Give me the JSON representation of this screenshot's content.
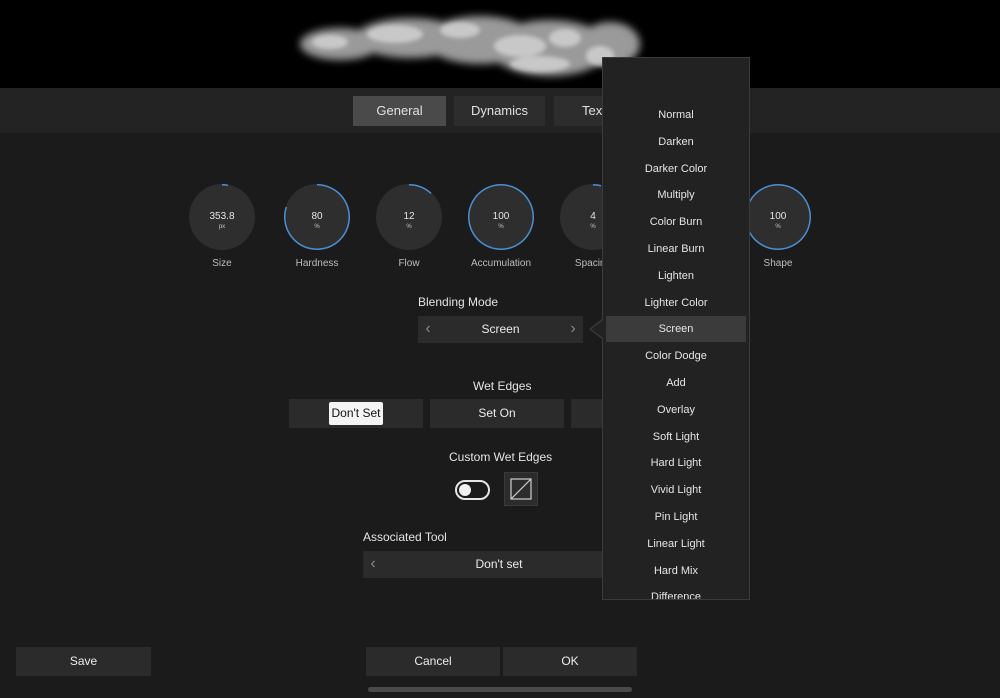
{
  "preview": {
    "icon": "brush-stroke-preview"
  },
  "tabs": [
    {
      "label": "General",
      "active": true
    },
    {
      "label": "Dynamics",
      "active": false
    },
    {
      "label": "Text",
      "active": false
    }
  ],
  "dials": [
    {
      "value": "353.8",
      "unit": "px",
      "label": "Size",
      "fill": 0.03
    },
    {
      "value": "80",
      "unit": "%",
      "label": "Hardness",
      "fill": 0.8
    },
    {
      "value": "12",
      "unit": "%",
      "label": "Flow",
      "fill": 0.12
    },
    {
      "value": "100",
      "unit": "%",
      "label": "Accumulation",
      "fill": 1.0
    },
    {
      "value": "4",
      "unit": "%",
      "label": "Spacing",
      "fill": 0.04
    },
    {
      "value": "100",
      "unit": "%",
      "label": "Shape",
      "fill": 1.0
    }
  ],
  "blending": {
    "label": "Blending Mode",
    "value": "Screen"
  },
  "wet_edges": {
    "label": "Wet Edges",
    "options": [
      "Don't Set",
      "Set On",
      ""
    ],
    "selected": "Don't Set"
  },
  "custom_wet_edges": {
    "label": "Custom Wet Edges",
    "enabled": false
  },
  "associated_tool": {
    "label": "Associated Tool",
    "value": "Don't set"
  },
  "buttons": {
    "save": "Save",
    "cancel": "Cancel",
    "ok": "OK"
  },
  "dropdown": {
    "items": [
      "Normal",
      "Darken",
      "Darker Color",
      "Multiply",
      "Color Burn",
      "Linear Burn",
      "Lighten",
      "Lighter Color",
      "Screen",
      "Color Dodge",
      "Add",
      "Overlay",
      "Soft Light",
      "Hard Light",
      "Vivid Light",
      "Pin Light",
      "Linear Light",
      "Hard Mix",
      "Difference"
    ],
    "selected": "Screen"
  },
  "colors": {
    "accent": "#4a8fd6",
    "background": "#1b1b1b",
    "panel": "#2b2b2b"
  }
}
